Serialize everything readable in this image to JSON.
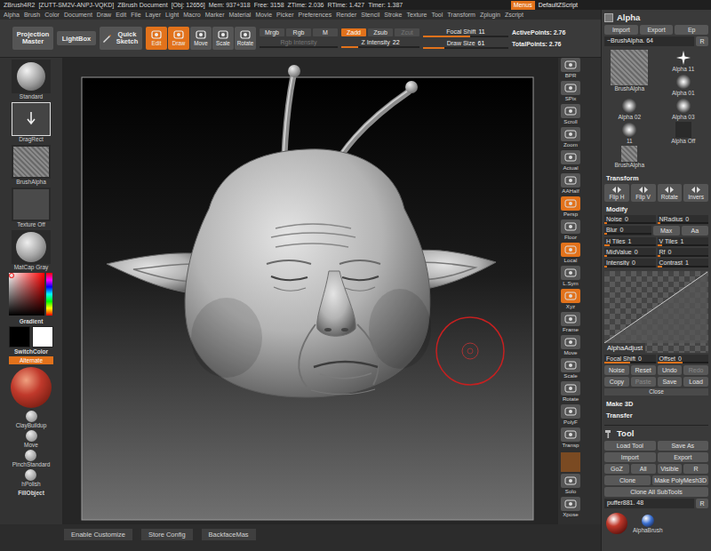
{
  "title_bar": {
    "items": [
      "ZBrush4R2",
      "[ZUTT-SM2V-ANPJ-VQKD]",
      "ZBrush Document",
      "[Obj: 12656]",
      "Mem: 937+318",
      "Free: 3158",
      "ZTime: 2.036",
      "RTime: 1.427",
      "Timer: 1.387"
    ],
    "menus_button": {
      "label": "Menus",
      "selected": true
    },
    "script": "DefaultZScript"
  },
  "menu_bar": [
    "Alpha",
    "Brush",
    "Color",
    "Document",
    "Draw",
    "Edit",
    "File",
    "Layer",
    "Light",
    "Macro",
    "Marker",
    "Material",
    "Movie",
    "Picker",
    "Preferences",
    "Render",
    "Stencil",
    "Stroke",
    "Texture",
    "Tool",
    "Transform",
    "Zplugin",
    "Zscript"
  ],
  "top_shelf": {
    "big_buttons": [
      "Projection Master",
      "LightBox",
      "Quick Sketch"
    ],
    "modes": [
      {
        "label": "Edit",
        "selected": true
      },
      {
        "label": "Draw",
        "selected": true
      },
      {
        "label": "Move",
        "selected": false
      },
      {
        "label": "Scale",
        "selected": false
      },
      {
        "label": "Rotate",
        "selected": false
      }
    ],
    "color_modes": [
      {
        "label": "Mrgb",
        "selected": false,
        "disabled": false
      },
      {
        "label": "Rgb",
        "selected": false,
        "disabled": false
      },
      {
        "label": "M",
        "selected": false,
        "disabled": false
      }
    ],
    "depth_modes": [
      {
        "label": "Zadd",
        "selected": true,
        "disabled": false
      },
      {
        "label": "Zsub",
        "selected": false,
        "disabled": false
      },
      {
        "label": "Zcut",
        "selected": false,
        "disabled": true
      }
    ],
    "sliders": [
      {
        "label": "Rgb Intensity",
        "level": 0,
        "disabled": true
      },
      {
        "label": "Z Intensity",
        "value": "22",
        "level": 0.22,
        "disabled": false
      },
      {
        "label": "Focal Shift",
        "value": "11",
        "level": 0.55,
        "disabled": false
      },
      {
        "label": "Draw Size",
        "value": "61",
        "level": 0.25,
        "disabled": false
      }
    ],
    "stats": [
      "ActivePoints: 2.76",
      "TotalPoints: 2.76"
    ]
  },
  "left_shelf": {
    "brush": "Standard",
    "stroke": "DragRect",
    "alpha": "BrushAlpha",
    "texture": "Texture Off",
    "material": "MatCap Gray",
    "gradient": "Gradient",
    "swatches": [
      {
        "color": "#000000"
      },
      {
        "color": "#ffffff"
      }
    ],
    "switch_color": "SwitchColor",
    "alternate": {
      "label": "Alternate",
      "selected": true
    },
    "brushes": [
      "ClayBuildup",
      "Move",
      "PinchStandard",
      "hPolish"
    ],
    "fill_object": "FillObject"
  },
  "right_shelf": [
    {
      "kind": "button",
      "label": "BPR",
      "selected": false
    },
    {
      "kind": "button",
      "label": "SPix",
      "selected": false
    },
    {
      "kind": "button",
      "label": "Scroll",
      "selected": false
    },
    {
      "kind": "button",
      "label": "Zoom",
      "selected": false
    },
    {
      "kind": "button",
      "label": "Actual",
      "selected": false
    },
    {
      "kind": "button",
      "label": "AAHalf",
      "selected": false
    },
    {
      "kind": "button",
      "label": "Persp",
      "selected": true
    },
    {
      "kind": "button",
      "label": "Floor",
      "selected": false
    },
    {
      "kind": "button",
      "label": "Local",
      "selected": true
    },
    {
      "kind": "button",
      "label": "L.Sym",
      "selected": false
    },
    {
      "kind": "button",
      "label": "Xyz",
      "selected": true
    },
    {
      "kind": "button",
      "label": "Frame",
      "selected": false
    },
    {
      "kind": "button",
      "label": "Move",
      "selected": false
    },
    {
      "kind": "button",
      "label": "Scale",
      "selected": false
    },
    {
      "kind": "button",
      "label": "Rotate",
      "selected": false
    },
    {
      "kind": "button",
      "label": "PolyF",
      "selected": false
    },
    {
      "kind": "button",
      "label": "Transp",
      "selected": false
    },
    {
      "kind": "swatch",
      "selected": true
    },
    {
      "kind": "button",
      "label": "Solo",
      "selected": false
    },
    {
      "kind": "button",
      "label": "Xpose",
      "selected": false
    }
  ],
  "palette": {
    "alpha": {
      "title": "Alpha",
      "buttons": [
        "Import",
        "Export",
        "Ep"
      ],
      "current": "~BrushAlpha. 64",
      "reset": "R",
      "items": [
        {
          "label": "BrushAlpha",
          "kind": "noise"
        },
        {
          "label": "Alpha 11",
          "kind": "star"
        },
        {
          "label": "Alpha 01",
          "kind": "dot"
        },
        {
          "label": "Alpha 02",
          "kind": "dot"
        },
        {
          "label": "Alpha 03",
          "kind": "dot"
        },
        {
          "label": "11",
          "kind": "dot"
        },
        {
          "label": "Alpha Off",
          "kind": "blank"
        },
        {
          "label": "BrushAlpha",
          "kind": "noise"
        }
      ]
    },
    "transform": {
      "title": "Transform",
      "buttons": [
        "Flip H",
        "Flip V",
        "Rotate",
        "Invers"
      ]
    },
    "modify": {
      "title": "Modify",
      "rows": [
        [
          {
            "kind": "slider",
            "label": "Noise",
            "value": "0",
            "level": 0
          },
          {
            "kind": "slider",
            "label": "NRadius",
            "value": "0",
            "level": 0
          }
        ],
        [
          {
            "kind": "slider",
            "label": "Blur",
            "value": "0",
            "level": 0
          },
          {
            "kind": "button",
            "label": "Max",
            "disabled": false
          },
          {
            "kind": "button",
            "label": "Aa",
            "disabled": false
          }
        ],
        [
          {
            "kind": "slider",
            "label": "H Tiles",
            "value": "1",
            "level": 0.1
          },
          {
            "kind": "slider",
            "label": "V Tiles",
            "value": "1",
            "level": 0.1
          }
        ],
        [
          {
            "kind": "slider",
            "label": "MidValue",
            "value": "0",
            "level": 0
          },
          {
            "kind": "slider",
            "label": "Rf",
            "value": "0",
            "level": 0
          }
        ],
        [
          {
            "kind": "slider",
            "label": "Intensity",
            "value": "0",
            "level": 0
          },
          {
            "kind": "slider",
            "label": "Contrast",
            "value": "1",
            "level": 0.1
          }
        ]
      ],
      "curve": {
        "label": "AlphaAdjust"
      },
      "curve_rows": [
        [
          {
            "kind": "slider",
            "label": "Focal Shift",
            "value": "0",
            "level": 0.5
          },
          {
            "kind": "slider",
            "label": "Offset",
            "value": "0",
            "level": 0.5
          }
        ],
        [
          {
            "kind": "button",
            "label": "Noise",
            "disabled": false
          },
          {
            "kind": "button",
            "label": "Reset",
            "disabled": false
          },
          {
            "kind": "button",
            "label": "Undo",
            "disabled": false
          },
          {
            "kind": "button",
            "label": "Redo",
            "disabled": true
          }
        ],
        [
          {
            "kind": "button",
            "label": "Copy",
            "disabled": false
          },
          {
            "kind": "button",
            "label": "Paste",
            "disabled": true
          },
          {
            "kind": "button",
            "label": "Save",
            "disabled": false
          },
          {
            "kind": "button",
            "label": "Load",
            "disabled": false
          }
        ]
      ],
      "close": "Close"
    },
    "sections": [
      "Make 3D",
      "Transfer"
    ],
    "tool": {
      "title": "Tool",
      "rows": [
        [
          "Load Tool",
          "Save As"
        ],
        [
          "Import",
          "Export"
        ],
        [
          "GoZ",
          "All",
          "Visible",
          "R"
        ],
        [
          "Clone",
          "Make PolyMesh3D"
        ],
        [
          "Clone All SubTools"
        ]
      ],
      "current": "puffer881. 48",
      "reset": "R",
      "thumbs": [
        {
          "kind": "sphere",
          "color": "#c0392b"
        },
        {
          "kind": "brush",
          "label": "AlphaBrush",
          "color": "#3a6fd0"
        }
      ]
    }
  },
  "bottom_bar": [
    "Enable Customize",
    "Store Config",
    "BackfaceMas"
  ]
}
